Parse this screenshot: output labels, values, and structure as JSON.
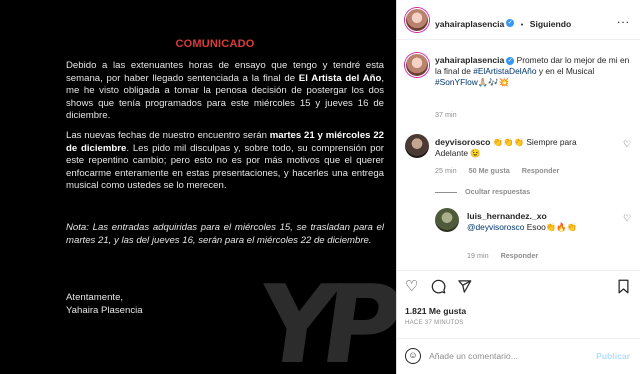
{
  "post_image": {
    "title": "COMUNICADO",
    "p1": {
      "a": "Debido a las extenuantes horas de ensayo que tengo y tendré esta semana, por haber llegado sentenciada a la final de ",
      "b": "El Artista del Año",
      "c": ", me he visto obligada a tomar la penosa decisión de postergar los dos shows que tenía programados para este miércoles 15 y jueves 16 de diciembre."
    },
    "p2": {
      "a": "Las nuevas fechas de nuestro encuentro serán ",
      "b": "martes 21 y miércoles 22 de diciembre",
      "c": ". Les pido mil disculpas y, sobre todo, su comprensión por este repentino cambio; pero esto no es por más motivos que el querer enfocarme enteramente en estas presentaciones, y hacerles una entrega musical como ustedes se lo merecen."
    },
    "note": "Nota: Las entradas adquiridas para el miércoles 15, se trasladan para el martes 21, y las del jueves 16, serán para el miércoles 22 de diciembre.",
    "closing": "Atentamente,",
    "signature": "Yahaira Plasencia",
    "watermark": "YP"
  },
  "header": {
    "username": "yahairaplasencia",
    "separator": "•",
    "follow_label": "Siguiendo",
    "more": "..."
  },
  "caption": {
    "username": "yahairaplasencia",
    "text_a": " Prometo dar lo mejor de mi en la final de ",
    "hashtag1": "#ElArtistaDelAño",
    "text_b": " y en el Musical ",
    "hashtag2": "#SonYFlow",
    "emojis": "🙏🏼🎶💥",
    "time": "37 min"
  },
  "comments": [
    {
      "username": "deyvisorosco",
      "text": " 👏👏👏 Siempre para Adelante 😉",
      "time": "25 min",
      "likes": "50 Me gusta",
      "reply_label": "Responder",
      "replies_toggle": "Ocultar respuestas"
    },
    {
      "username": "luis_hernandez._xo",
      "mention": "@deyvisorosco",
      "text": " Esoo👏🔥👏",
      "time": "19 min",
      "reply_label": "Responder"
    }
  ],
  "actions": {
    "likes": "1.821 Me gusta",
    "time_ago": "HACE 37 MINUTOS"
  },
  "comment_box": {
    "placeholder": "Añade un comentario...",
    "publish_label": "Publicar"
  },
  "colors": {
    "title_red": "#d93a3a",
    "link_blue": "#00376b",
    "verified_blue": "#3897f0",
    "publish_disabled": "#b2dffc"
  }
}
